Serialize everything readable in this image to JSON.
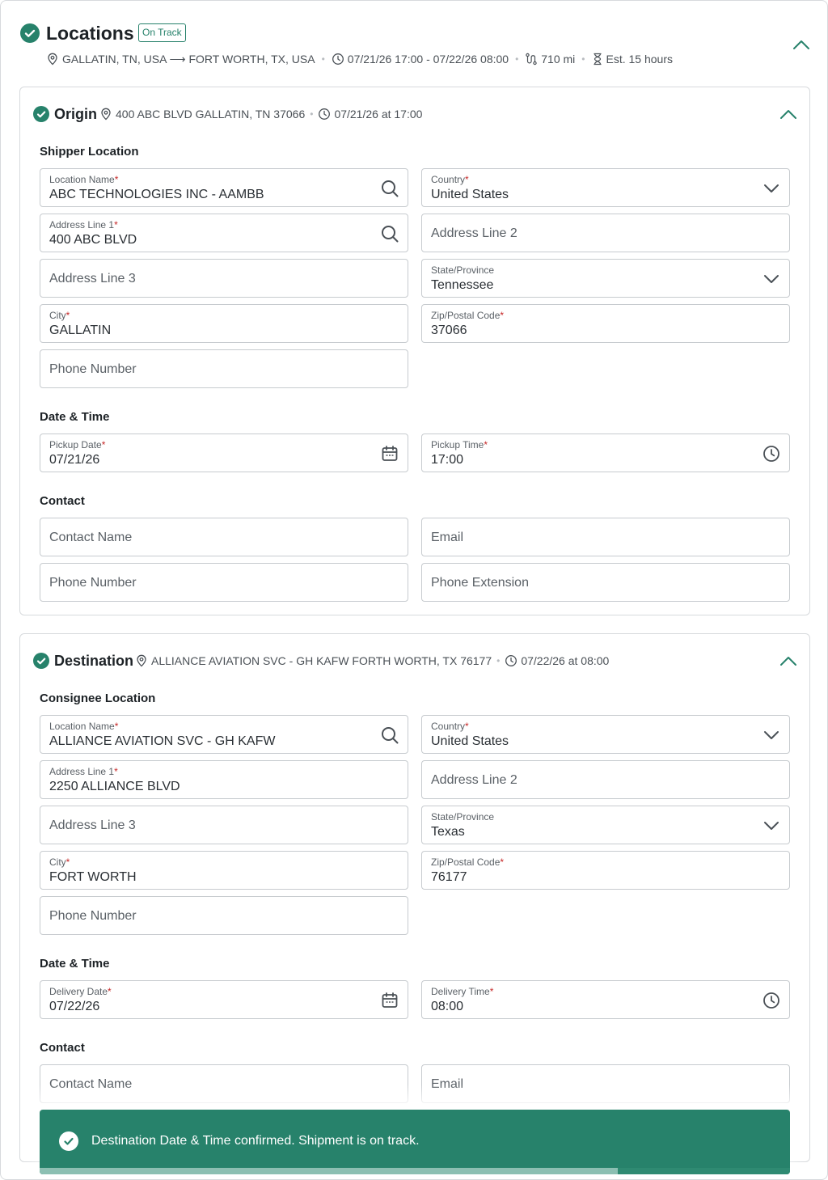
{
  "header": {
    "title": "Locations",
    "badge": "On Track",
    "route": "GALLATIN, TN, USA ⟶ FORT WORTH, TX, USA",
    "window": "07/21/26 17:00 - 07/22/26 08:00",
    "distance": "710 mi",
    "duration": "Est. 15 hours"
  },
  "origin": {
    "title": "Origin",
    "address": "400 ABC BLVD GALLATIN, TN 37066",
    "when": "07/21/26 at 17:00",
    "location_heading": "Shipper Location",
    "location_name": {
      "label": "Location Name",
      "value": "ABC TECHNOLOGIES INC - AAMBB"
    },
    "country": {
      "label": "Country",
      "value": "United States"
    },
    "address1": {
      "label": "Address Line 1",
      "value": "400 ABC BLVD"
    },
    "address2": {
      "placeholder": "Address Line 2"
    },
    "address3": {
      "placeholder": "Address Line 3"
    },
    "state": {
      "label": "State/Province",
      "value": "Tennessee"
    },
    "city": {
      "label": "City",
      "value": "GALLATIN"
    },
    "zip": {
      "label": "Zip/Postal Code",
      "value": "37066"
    },
    "phone": {
      "placeholder": "Phone Number"
    },
    "datetime_heading": "Date & Time",
    "date": {
      "label": "Pickup Date",
      "value": "07/21/26"
    },
    "time": {
      "label": "Pickup Time",
      "value": "17:00"
    },
    "contact_heading": "Contact",
    "contact_name": {
      "placeholder": "Contact Name"
    },
    "email": {
      "placeholder": "Email"
    },
    "contact_phone": {
      "placeholder": "Phone Number"
    },
    "phone_ext": {
      "placeholder": "Phone Extension"
    }
  },
  "destination": {
    "title": "Destination",
    "address": "ALLIANCE AVIATION SVC - GH KAFW FORTH WORTH, TX 76177",
    "when": "07/22/26 at 08:00",
    "location_heading": "Consignee Location",
    "location_name": {
      "label": "Location Name",
      "value": "ALLIANCE AVIATION SVC - GH KAFW"
    },
    "country": {
      "label": "Country",
      "value": "United States"
    },
    "address1": {
      "label": "Address Line 1",
      "value": "2250 ALLIANCE BLVD"
    },
    "address2": {
      "placeholder": "Address Line 2"
    },
    "address3": {
      "placeholder": "Address Line 3"
    },
    "state": {
      "label": "State/Province",
      "value": "Texas"
    },
    "city": {
      "label": "City",
      "value": "FORT WORTH"
    },
    "zip": {
      "label": "Zip/Postal Code",
      "value": "76177"
    },
    "phone": {
      "placeholder": "Phone Number"
    },
    "datetime_heading": "Date & Time",
    "date": {
      "label": "Delivery Date",
      "value": "07/22/26"
    },
    "time": {
      "label": "Delivery Time",
      "value": "08:00"
    },
    "contact_heading": "Contact",
    "contact_name": {
      "placeholder": "Contact Name"
    },
    "email": {
      "placeholder": "Email"
    }
  },
  "toast": {
    "message": "Destination Date & Time confirmed. Shipment is on track.",
    "progress": 0.77
  },
  "colors": {
    "accent": "#27826b",
    "required": "#c62828",
    "border": "#c7cbcf"
  },
  "icons": [
    "check-circle-icon",
    "map-pin-icon",
    "clock-icon",
    "route-icon",
    "hourglass-icon",
    "chevron-up-icon",
    "chevron-down-icon",
    "search-icon",
    "calendar-icon"
  ]
}
